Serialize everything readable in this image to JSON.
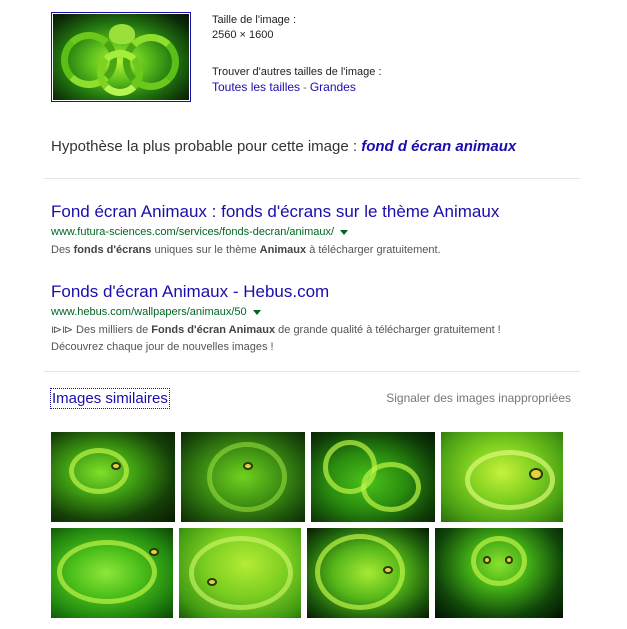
{
  "image_info": {
    "size_label": "Taille de l'image :",
    "dimensions": "2560 × 1600",
    "find_other_sizes": "Trouver d'autres tailles de l'image :",
    "all_sizes": "Toutes les tailles",
    "separator": " - ",
    "large": "Grandes"
  },
  "best_guess": {
    "label": "Hypothèse la plus probable pour cette image : ",
    "query": "fond d écran animaux"
  },
  "results": [
    {
      "title": "Fond écran Animaux : fonds d'écrans sur le thème Animaux",
      "url": "www.futura-sciences.com/services/fonds-decran/animaux/",
      "snippet_parts": [
        "Des ",
        "fonds d'écrans",
        " uniques sur le thème ",
        "Animaux",
        " à télécharger gratuitement."
      ]
    },
    {
      "title": "Fonds d'écran Animaux - Hebus.com",
      "url": "www.hebus.com/wallpapers/animaux/50",
      "snippet_parts": [
        "⧐⧐ Des milliers de ",
        "Fonds d'écran Animaux",
        " de grande qualité à télécharger gratuitement ! Découvrez chaque jour de nouvelles images !"
      ]
    }
  ],
  "similar": {
    "link_label": "Images similaires",
    "report_label": "Signaler des images inappropriées"
  },
  "colors": {
    "link": "#1a0dab",
    "url_green": "#006621",
    "snippet": "#545454"
  }
}
